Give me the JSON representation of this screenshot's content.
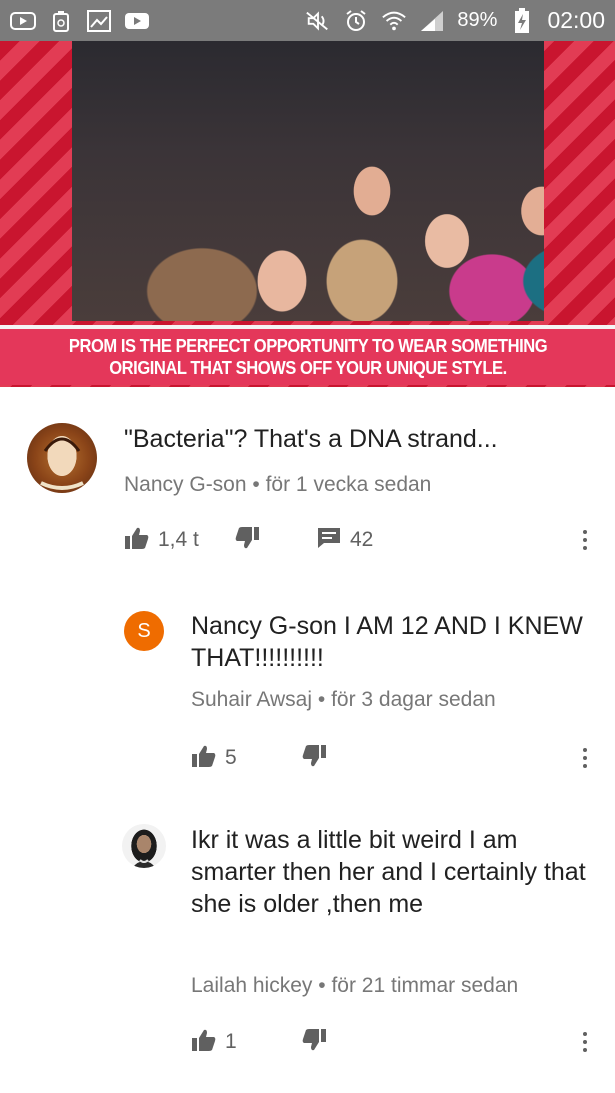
{
  "status_bar": {
    "left_icons": [
      "youtube-icon",
      "recycle-icon",
      "gallery-icon",
      "youtube-icon"
    ],
    "right_icons": [
      "mute-icon",
      "alarm-icon",
      "wifi-icon",
      "signal-icon"
    ],
    "battery": "89%",
    "time": "02:00"
  },
  "video": {
    "banner_line1": "PROM IS THE PERFECT OPPORTUNITY TO WEAR SOMETHING",
    "banner_line2": "ORIGINAL THAT SHOWS OFF YOUR UNIQUE STYLE."
  },
  "comments": [
    {
      "text": "\"Bacteria\"? That's a DNA strand...",
      "author": "Nancy G-son",
      "separator": "•",
      "time": "för 1 vecka sedan",
      "likes": "1,4 t",
      "replies": "42"
    },
    {
      "avatar_letter": "S",
      "text": "Nancy G-son I AM 12 AND I KNEW THAT!!!!!!!!!!",
      "author": "Suhair Awsaj",
      "separator": "•",
      "time": "för 3 dagar sedan",
      "likes": "5"
    },
    {
      "text": "Ikr it was a little bit weird I am smarter then her and I certainly that she is older ,then me",
      "author": "Lailah hickey",
      "separator": "•",
      "time": "för 21 timmar sedan",
      "likes": "1"
    }
  ],
  "colors": {
    "status_bar": "#7b7b7b",
    "banner": "#e4375a",
    "avatar_s": "#ef6c00",
    "meta_text": "#777777"
  }
}
